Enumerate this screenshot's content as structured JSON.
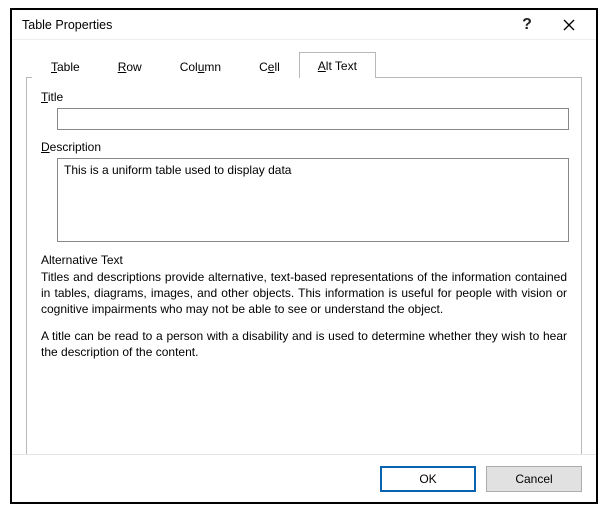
{
  "dialog": {
    "title": "Table Properties",
    "help_symbol": "?"
  },
  "tabs": {
    "table": {
      "underline": "T",
      "rest": "able"
    },
    "row": {
      "underline": "R",
      "rest": "ow"
    },
    "column": {
      "pre": "Col",
      "underline": "u",
      "rest": "mn"
    },
    "cell": {
      "pre": "C",
      "underline": "e",
      "rest": "ll"
    },
    "alttext": {
      "underline": "A",
      "rest": "lt Text"
    }
  },
  "fields": {
    "title_label_underline": "T",
    "title_label_rest": "itle",
    "title_value": "",
    "desc_label_underline": "D",
    "desc_label_rest": "escription",
    "desc_value": "This is a uniform table used to display data"
  },
  "help": {
    "heading": "Alternative Text",
    "para1": "Titles and descriptions provide alternative, text-based representations of the information contained in tables, diagrams, images, and other objects. This information is useful for people with vision or cognitive impairments who may not be able to see or understand the object.",
    "para2": "A title can be read to a person with a disability and is used to determine whether they wish to hear the description of the content."
  },
  "buttons": {
    "ok": "OK",
    "cancel": "Cancel"
  }
}
